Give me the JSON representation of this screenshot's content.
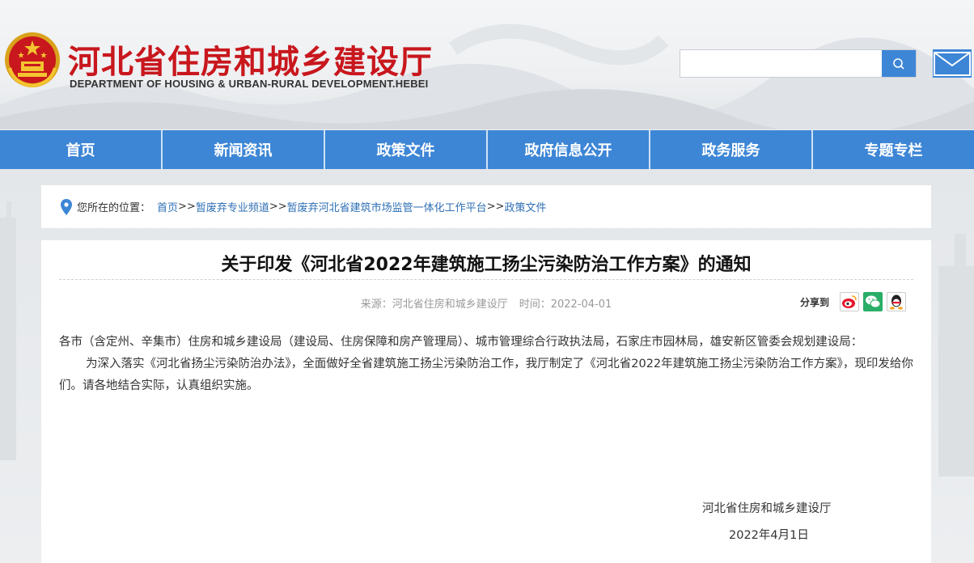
{
  "header": {
    "title": "河北省住房和城乡建设厅",
    "subtitle": "DEPARTMENT OF HOUSING & URBAN-RURAL DEVELOPMENT.HEBEI",
    "search": {
      "value": "",
      "placeholder": ""
    },
    "icons": {
      "emblem": "national-emblem-icon",
      "search": "search-icon",
      "mail": "mail-icon"
    }
  },
  "nav": {
    "items": [
      {
        "label": "首页"
      },
      {
        "label": "新闻资讯"
      },
      {
        "label": "政策文件"
      },
      {
        "label": "政府信息公开"
      },
      {
        "label": "政务服务"
      },
      {
        "label": "专题专栏"
      }
    ]
  },
  "breadcrumb": {
    "prefix": "您所在的位置：",
    "items": [
      "首页",
      "暂废弃专业频道",
      "暂废弃河北省建筑市场监管一体化工作平台",
      "政策文件"
    ],
    "separator": ">>"
  },
  "article": {
    "title": "关于印发《河北省2022年建筑施工扬尘污染防治工作方案》的通知",
    "meta": {
      "source": "来源：河北省住房和城乡建设厅",
      "time": "时间：2022-04-01"
    },
    "share": {
      "label": "分享到",
      "targets": [
        "weibo-icon",
        "wechat-icon",
        "qq-icon"
      ]
    },
    "paragraphs": [
      "各市（含定州、辛集市）住房和城乡建设局（建设局、住房保障和房产管理局）、城市管理综合行政执法局，石家庄市园林局，雄安新区管委会规划建设局：",
      "为深入落实《河北省扬尘污染防治办法》，全面做好全省建筑施工扬尘污染防治工作，我厅制定了《河北省2022年建筑施工扬尘污染防治工作方案》，现印发给你们。请各地结合实际，认真组织实施。"
    ],
    "signature": "河北省住房和城乡建设厅",
    "date": "2022年4月1日"
  },
  "colors": {
    "brand_red": "#c8171d",
    "nav_blue": "#3d86d6",
    "link_blue": "#2f6fb5"
  }
}
